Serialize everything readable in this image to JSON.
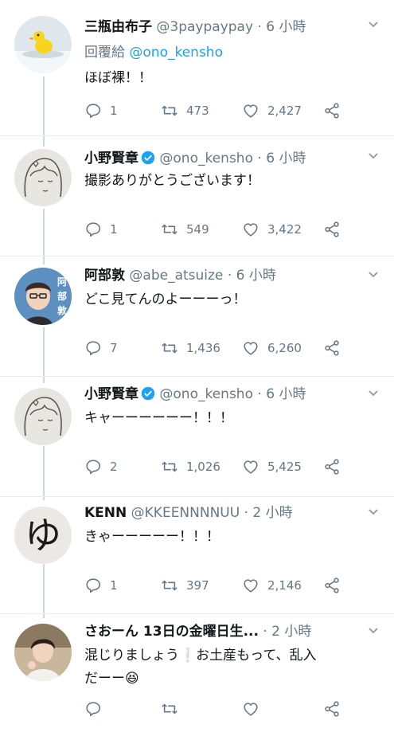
{
  "colors": {
    "link": "#1da1f2",
    "muted": "#657786",
    "text": "#14171a",
    "divider": "#e6ecf0",
    "thread": "#ccd6dd",
    "verified": "#1da1f2"
  },
  "tweets": [
    {
      "name": "三瓶由布子",
      "handle": "@3paypaypay",
      "dot": "·",
      "time": "6 小時",
      "verified": false,
      "reply_prefix": "回覆給",
      "reply_handle": "@ono_kensho",
      "text": "ほぼ裸！！",
      "replies": "1",
      "retweets": "473",
      "likes": "2,427",
      "avatar": "duck-avatar"
    },
    {
      "name": "小野賢章",
      "handle": "@ono_kensho",
      "dot": "·",
      "time": "6 小時",
      "verified": true,
      "text": "撮影ありがとうございます！",
      "replies": "1",
      "retweets": "549",
      "likes": "3,422",
      "avatar": "sketch-avatar"
    },
    {
      "name": "阿部敦",
      "handle": "@abe_atsuize",
      "dot": "·",
      "time": "6 小時",
      "verified": false,
      "text": "どこ見てんのよーーーっ！",
      "replies": "7",
      "retweets": "1,436",
      "likes": "6,260",
      "avatar": "photo-avatar",
      "avatar_text": [
        "阿",
        "部",
        "敦"
      ]
    },
    {
      "name": "小野賢章",
      "handle": "@ono_kensho",
      "dot": "·",
      "time": "6 小時",
      "verified": true,
      "text": "キャーーーーーー！！！",
      "replies": "2",
      "retweets": "1,026",
      "likes": "5,425",
      "avatar": "sketch-avatar"
    },
    {
      "name": "KENN",
      "handle": "@KKEENNNNUU",
      "dot": "·",
      "time": "2 小時",
      "verified": false,
      "text": "きゃーーーーー！！！",
      "replies": "1",
      "retweets": "397",
      "likes": "2,146",
      "avatar": "calligraphy-avatar",
      "avatar_text": "ゆ"
    },
    {
      "name": "さおーん 13日の金曜日生...",
      "handle": "",
      "dot": "·",
      "time": "2 小時",
      "verified": false,
      "text_a": "混じりましょう",
      "text_emoji": "❕",
      "text_b": "お土産もって、乱入",
      "text_c": "だーー",
      "text_emoji2": "😆",
      "replies": "",
      "retweets": "",
      "likes": "",
      "avatar": "woman-avatar"
    }
  ]
}
